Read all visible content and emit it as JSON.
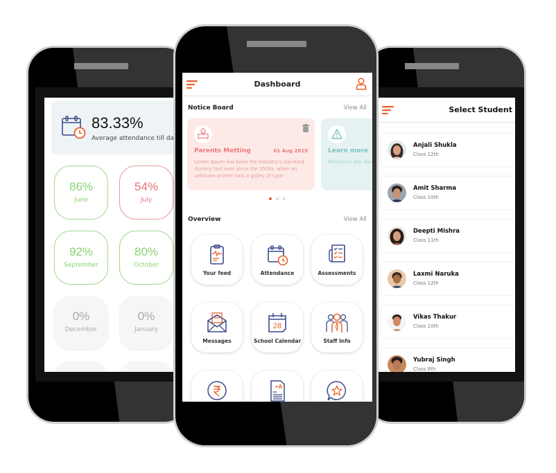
{
  "colors": {
    "accent": "#e8622d",
    "navy": "#3b4a8a",
    "good": "#8bd274",
    "bad": "#e07474",
    "muted": "#a9a9a9"
  },
  "attendance": {
    "summary_percent": "83.33%",
    "summary_label": "Average attendance till date",
    "months": [
      {
        "percent": "86%",
        "name": "June",
        "status": "good"
      },
      {
        "percent": "54%",
        "name": "July",
        "status": "bad"
      },
      {
        "percent": "92%",
        "name": "September",
        "status": "good"
      },
      {
        "percent": "80%",
        "name": "October",
        "status": "good"
      },
      {
        "percent": "0%",
        "name": "December",
        "status": "none"
      },
      {
        "percent": "0%",
        "name": "January",
        "status": "none"
      }
    ]
  },
  "dashboard": {
    "title": "Dashboard",
    "notice_board": {
      "title": "Notice Board",
      "view_all": "View All",
      "cards": [
        {
          "icon": "reading-person-icon",
          "title": "Parents Metting",
          "date": "01 Aug 2019",
          "body": "Lorem Ipsum has been the industry's standard dummy text ever since the 1500s, when an unknown printer took a galley of type"
        },
        {
          "icon": "warning-icon",
          "title": "Learn more",
          "date": "",
          "body": "Reference site about information on its Lipsum generator"
        }
      ],
      "pagination": {
        "total": 3,
        "active": 1
      }
    },
    "overview": {
      "title": "Overview",
      "view_all": "View All",
      "tiles": [
        {
          "label": "Your feed",
          "icon": "clipboard-feed-icon"
        },
        {
          "label": "Attendance",
          "icon": "calendar-clock-icon"
        },
        {
          "label": "Assessments",
          "icon": "checklist-icon"
        },
        {
          "label": "Messages",
          "icon": "envelope-icon"
        },
        {
          "label": "School Calendar",
          "icon": "calendar-28-icon",
          "calendar_day": "28"
        },
        {
          "label": "Staff Info",
          "icon": "staff-icon"
        },
        {
          "label": "",
          "icon": "rupee-icon"
        },
        {
          "label": "",
          "icon": "grade-document-icon",
          "grade": "+A"
        },
        {
          "label": "",
          "icon": "star-chat-icon"
        }
      ]
    }
  },
  "students": {
    "title": "Select Student",
    "list": [
      {
        "name": "Anjali Shukla",
        "class": "Class 12th"
      },
      {
        "name": "Amit Sharma",
        "class": "Class 10th"
      },
      {
        "name": "Deepti Mishra",
        "class": "Class 11th"
      },
      {
        "name": "Laxmi Naruka",
        "class": "Class 12th"
      },
      {
        "name": "Vikas Thakur",
        "class": "Class 10th"
      },
      {
        "name": "Yubraj Singh",
        "class": "Class 8th"
      }
    ]
  }
}
